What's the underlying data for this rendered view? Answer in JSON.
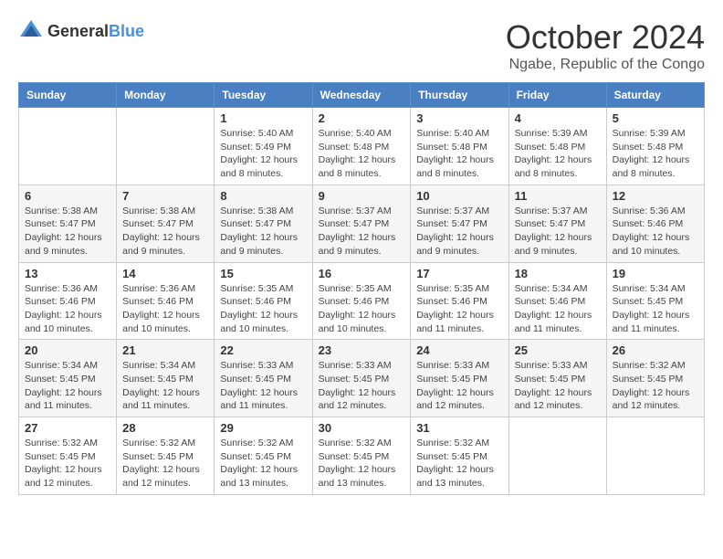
{
  "header": {
    "logo_general": "General",
    "logo_blue": "Blue",
    "month_title": "October 2024",
    "location": "Ngabe, Republic of the Congo"
  },
  "calendar": {
    "days_of_week": [
      "Sunday",
      "Monday",
      "Tuesday",
      "Wednesday",
      "Thursday",
      "Friday",
      "Saturday"
    ],
    "weeks": [
      [
        {
          "day": "",
          "info": ""
        },
        {
          "day": "",
          "info": ""
        },
        {
          "day": "1",
          "info": "Sunrise: 5:40 AM\nSunset: 5:49 PM\nDaylight: 12 hours and 8 minutes."
        },
        {
          "day": "2",
          "info": "Sunrise: 5:40 AM\nSunset: 5:48 PM\nDaylight: 12 hours and 8 minutes."
        },
        {
          "day": "3",
          "info": "Sunrise: 5:40 AM\nSunset: 5:48 PM\nDaylight: 12 hours and 8 minutes."
        },
        {
          "day": "4",
          "info": "Sunrise: 5:39 AM\nSunset: 5:48 PM\nDaylight: 12 hours and 8 minutes."
        },
        {
          "day": "5",
          "info": "Sunrise: 5:39 AM\nSunset: 5:48 PM\nDaylight: 12 hours and 8 minutes."
        }
      ],
      [
        {
          "day": "6",
          "info": "Sunrise: 5:38 AM\nSunset: 5:47 PM\nDaylight: 12 hours and 9 minutes."
        },
        {
          "day": "7",
          "info": "Sunrise: 5:38 AM\nSunset: 5:47 PM\nDaylight: 12 hours and 9 minutes."
        },
        {
          "day": "8",
          "info": "Sunrise: 5:38 AM\nSunset: 5:47 PM\nDaylight: 12 hours and 9 minutes."
        },
        {
          "day": "9",
          "info": "Sunrise: 5:37 AM\nSunset: 5:47 PM\nDaylight: 12 hours and 9 minutes."
        },
        {
          "day": "10",
          "info": "Sunrise: 5:37 AM\nSunset: 5:47 PM\nDaylight: 12 hours and 9 minutes."
        },
        {
          "day": "11",
          "info": "Sunrise: 5:37 AM\nSunset: 5:47 PM\nDaylight: 12 hours and 9 minutes."
        },
        {
          "day": "12",
          "info": "Sunrise: 5:36 AM\nSunset: 5:46 PM\nDaylight: 12 hours and 10 minutes."
        }
      ],
      [
        {
          "day": "13",
          "info": "Sunrise: 5:36 AM\nSunset: 5:46 PM\nDaylight: 12 hours and 10 minutes."
        },
        {
          "day": "14",
          "info": "Sunrise: 5:36 AM\nSunset: 5:46 PM\nDaylight: 12 hours and 10 minutes."
        },
        {
          "day": "15",
          "info": "Sunrise: 5:35 AM\nSunset: 5:46 PM\nDaylight: 12 hours and 10 minutes."
        },
        {
          "day": "16",
          "info": "Sunrise: 5:35 AM\nSunset: 5:46 PM\nDaylight: 12 hours and 10 minutes."
        },
        {
          "day": "17",
          "info": "Sunrise: 5:35 AM\nSunset: 5:46 PM\nDaylight: 12 hours and 11 minutes."
        },
        {
          "day": "18",
          "info": "Sunrise: 5:34 AM\nSunset: 5:46 PM\nDaylight: 12 hours and 11 minutes."
        },
        {
          "day": "19",
          "info": "Sunrise: 5:34 AM\nSunset: 5:45 PM\nDaylight: 12 hours and 11 minutes."
        }
      ],
      [
        {
          "day": "20",
          "info": "Sunrise: 5:34 AM\nSunset: 5:45 PM\nDaylight: 12 hours and 11 minutes."
        },
        {
          "day": "21",
          "info": "Sunrise: 5:34 AM\nSunset: 5:45 PM\nDaylight: 12 hours and 11 minutes."
        },
        {
          "day": "22",
          "info": "Sunrise: 5:33 AM\nSunset: 5:45 PM\nDaylight: 12 hours and 11 minutes."
        },
        {
          "day": "23",
          "info": "Sunrise: 5:33 AM\nSunset: 5:45 PM\nDaylight: 12 hours and 12 minutes."
        },
        {
          "day": "24",
          "info": "Sunrise: 5:33 AM\nSunset: 5:45 PM\nDaylight: 12 hours and 12 minutes."
        },
        {
          "day": "25",
          "info": "Sunrise: 5:33 AM\nSunset: 5:45 PM\nDaylight: 12 hours and 12 minutes."
        },
        {
          "day": "26",
          "info": "Sunrise: 5:32 AM\nSunset: 5:45 PM\nDaylight: 12 hours and 12 minutes."
        }
      ],
      [
        {
          "day": "27",
          "info": "Sunrise: 5:32 AM\nSunset: 5:45 PM\nDaylight: 12 hours and 12 minutes."
        },
        {
          "day": "28",
          "info": "Sunrise: 5:32 AM\nSunset: 5:45 PM\nDaylight: 12 hours and 12 minutes."
        },
        {
          "day": "29",
          "info": "Sunrise: 5:32 AM\nSunset: 5:45 PM\nDaylight: 12 hours and 13 minutes."
        },
        {
          "day": "30",
          "info": "Sunrise: 5:32 AM\nSunset: 5:45 PM\nDaylight: 12 hours and 13 minutes."
        },
        {
          "day": "31",
          "info": "Sunrise: 5:32 AM\nSunset: 5:45 PM\nDaylight: 12 hours and 13 minutes."
        },
        {
          "day": "",
          "info": ""
        },
        {
          "day": "",
          "info": ""
        }
      ]
    ]
  }
}
